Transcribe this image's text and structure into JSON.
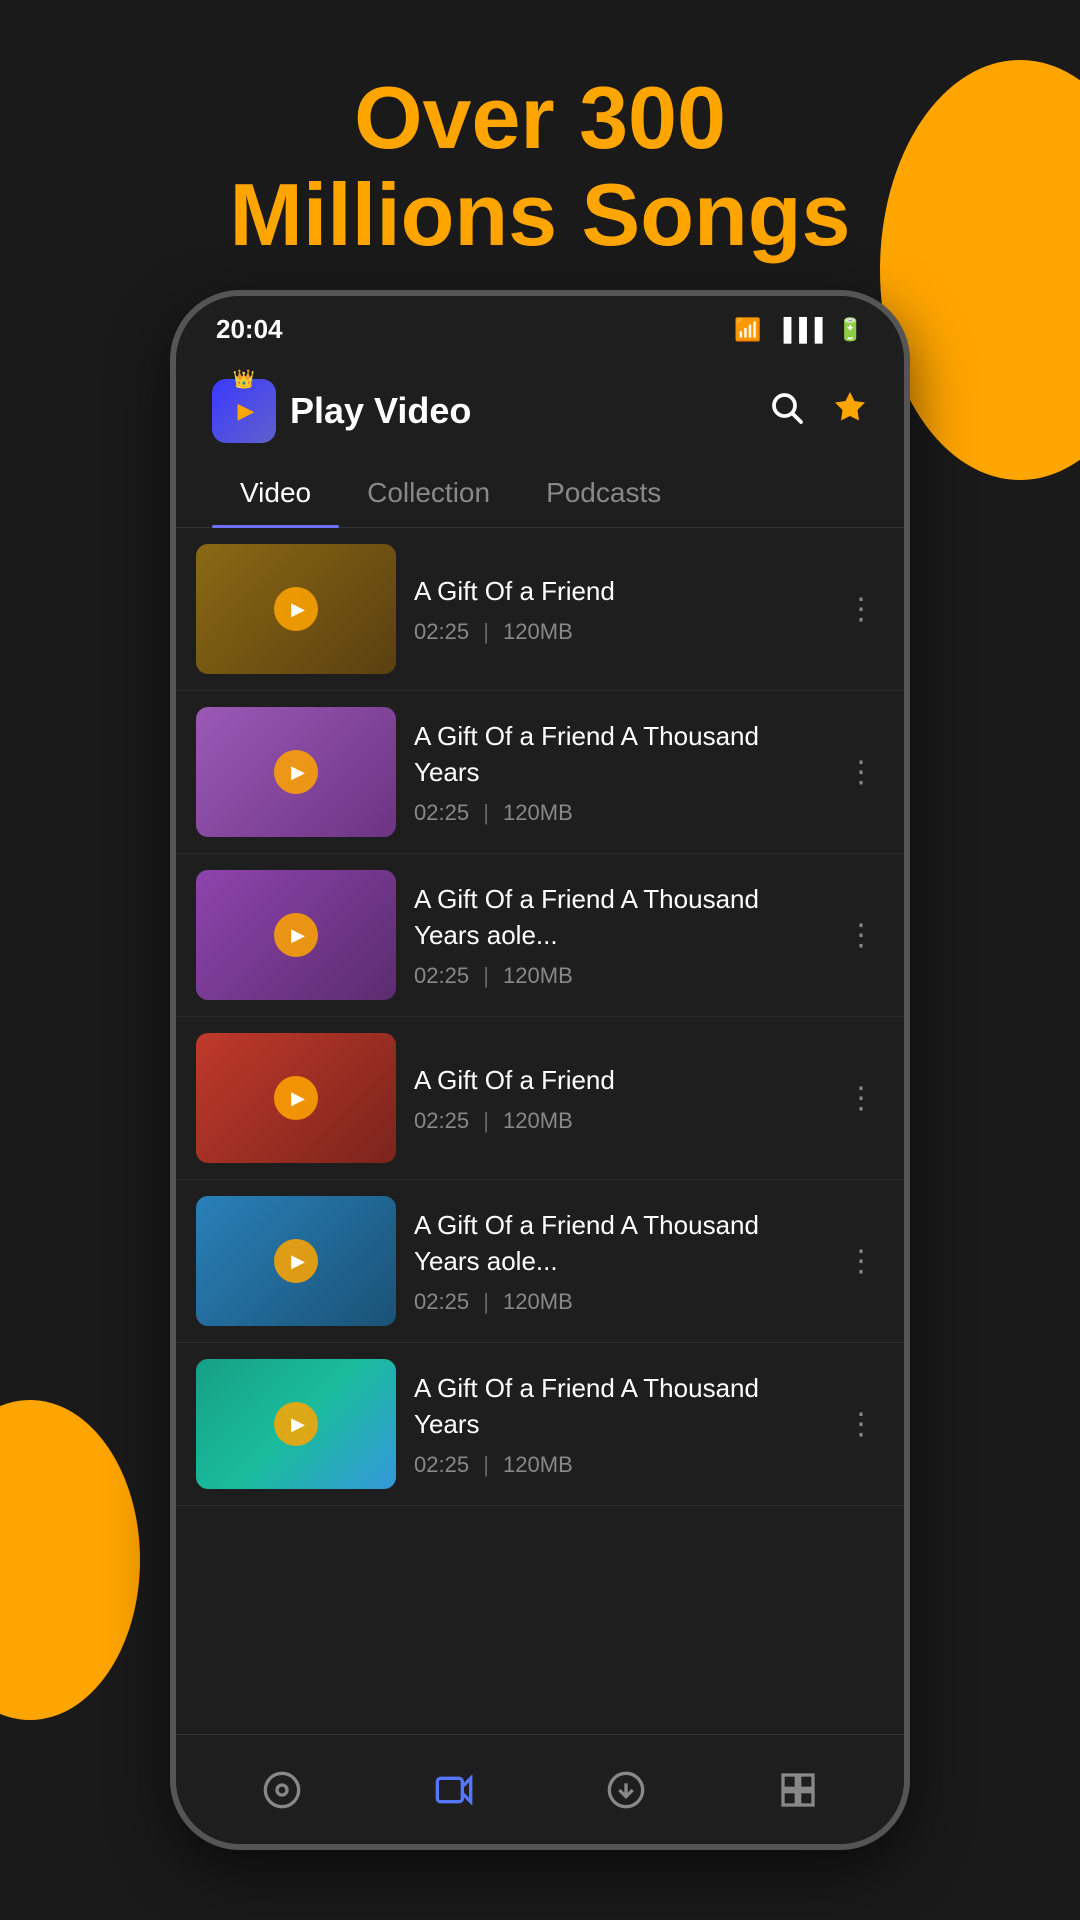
{
  "background": {
    "color": "#1a1a1a"
  },
  "hero": {
    "line1_prefix": "Over ",
    "line1_highlight": "300",
    "line2": "Millions Songs"
  },
  "status_bar": {
    "time": "20:04",
    "icons": [
      "wifi",
      "signal",
      "battery"
    ]
  },
  "app_header": {
    "title": "Play Video",
    "search_label": "search",
    "crown_label": "premium"
  },
  "tabs": [
    {
      "id": "video",
      "label": "Video",
      "active": true
    },
    {
      "id": "collection",
      "label": "Collection",
      "active": false
    },
    {
      "id": "podcasts",
      "label": "Podcasts",
      "active": false
    }
  ],
  "videos": [
    {
      "id": 1,
      "title": "A Gift Of a Friend",
      "duration": "02:25",
      "size": "120MB",
      "thumb_color1": "#8B6914",
      "thumb_color2": "#5a4010"
    },
    {
      "id": 2,
      "title": "A Gift Of a Friend A Thousand Years",
      "duration": "02:25",
      "size": "120MB",
      "thumb_color1": "#9b59b6",
      "thumb_color2": "#6c3483"
    },
    {
      "id": 3,
      "title": "A Gift Of a Friend A Thousand Years aole...",
      "duration": "02:25",
      "size": "120MB",
      "thumb_color1": "#8e44ad",
      "thumb_color2": "#5b2c6f"
    },
    {
      "id": 4,
      "title": "A Gift Of a Friend",
      "duration": "02:25",
      "size": "120MB",
      "thumb_color1": "#c0392b",
      "thumb_color2": "#7b241c"
    },
    {
      "id": 5,
      "title": "A Gift Of a Friend A Thousand Years aole...",
      "duration": "02:25",
      "size": "120MB",
      "thumb_color1": "#2980b9",
      "thumb_color2": "#1a5276"
    },
    {
      "id": 6,
      "title": "A Gift Of a Friend A Thousand Years",
      "duration": "02:25",
      "size": "120MB",
      "thumb_color1": "#27ae60",
      "thumb_color2": "#1e8449"
    }
  ],
  "bottom_nav": [
    {
      "id": "music",
      "label": "music",
      "icon": "♫",
      "active": false
    },
    {
      "id": "video",
      "label": "video",
      "icon": "🎬",
      "active": false
    },
    {
      "id": "download",
      "label": "download",
      "icon": "⬇",
      "active": false
    },
    {
      "id": "library",
      "label": "library",
      "icon": "⊞",
      "active": false
    }
  ],
  "colors": {
    "accent": "#FFA500",
    "active_tab": "#7070ff",
    "bg_dark": "#1e1e1e",
    "bg_darker": "#1a1a1a",
    "text_primary": "#ffffff",
    "text_secondary": "#888888"
  }
}
